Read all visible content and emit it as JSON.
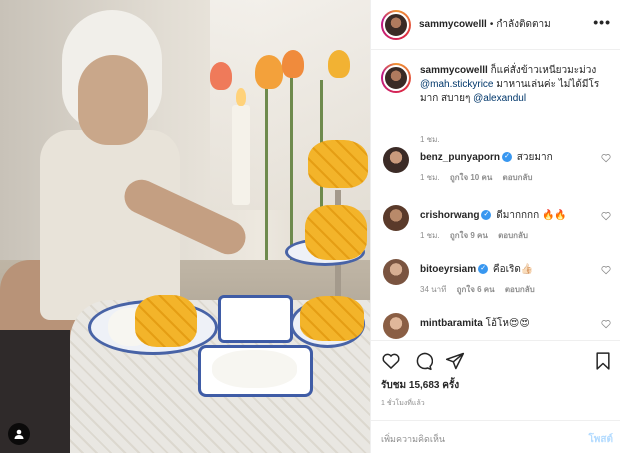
{
  "post": {
    "username": "sammycowelll",
    "follow_label": "กำลังติดตาม",
    "more_label": "•••",
    "caption_prefix": "ก็แค่สั่งข้าวเหนียวมะม่วง",
    "caption_mention1": "@mah.stickyrice",
    "caption_middle": "มาหานเล่นค่ะ ไม่ได้มีโรมาก สบายๆ",
    "caption_mention2": "@alexandul",
    "caption_time": "1 ชม."
  },
  "comments": [
    {
      "username": "benz_punyaporn",
      "verified": true,
      "text": "สวยมาก",
      "time": "1 ชม.",
      "likes": "ถูกใจ 10 คน",
      "reply": "ตอบกลับ",
      "avatar_color": "#6b4a3a"
    },
    {
      "username": "crishorwang",
      "verified": true,
      "text": "ดีมากกกก 🔥🔥",
      "time": "1 ชม.",
      "likes": "ถูกใจ 9 คน",
      "reply": "ตอบกลับ",
      "avatar_color": "#8a5d3f"
    },
    {
      "username": "bitoeyrsiam",
      "verified": true,
      "text": "คือเริด👍🏻",
      "time": "34 นาที",
      "likes": "ถูกใจ 6 คน",
      "reply": "ตอบกลับ",
      "avatar_color": "#a0735a"
    },
    {
      "username": "mintbaramita",
      "verified": false,
      "text": "โอ้โห😍😍",
      "time": "",
      "likes": "",
      "reply": "",
      "avatar_color": "#c08a6a"
    }
  ],
  "stats": {
    "views": "รับชม 15,683 ครั้ง",
    "posted_ago": "1 ชั่วโมงที่แล้ว"
  },
  "composer": {
    "placeholder": "เพิ่มความคิดเห็น",
    "post_label": "โพสต์"
  },
  "colors": {
    "mention": "#00376b",
    "verified": "#3897f0",
    "post_disabled": "#b3dbff",
    "meta": "#8e8e8e"
  },
  "icons": [
    "tag-person-icon",
    "more-icon",
    "heart-icon",
    "comment-icon",
    "share-icon",
    "save-icon",
    "verified-icon"
  ]
}
